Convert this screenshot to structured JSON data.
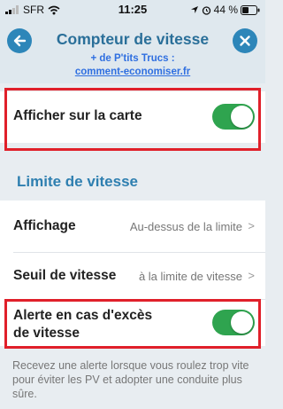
{
  "status": {
    "carrier": "SFR",
    "time": "11:25",
    "battery": "44 %"
  },
  "header": {
    "title": "Compteur de vitesse",
    "watermark_line1": "+ de P'tits Trucs :",
    "watermark_line2": "comment-economiser.fr"
  },
  "rows": {
    "show_on_map": {
      "label": "Afficher sur la carte",
      "enabled": true
    },
    "section_title": "Limite de vitesse",
    "display": {
      "label": "Affichage",
      "value": "Au-dessus de la limite"
    },
    "threshold": {
      "label": "Seuil de vitesse",
      "value": "à la limite de vitesse"
    },
    "alert": {
      "label_line1": "Alerte en cas d'excès",
      "label_line2": "de vitesse",
      "enabled": true
    }
  },
  "footnote": "Recevez une alerte lorsque vous roulez trop vite pour éviter les PV et adopter une conduite plus sûre.",
  "colors": {
    "accent": "#2d86b9",
    "toggle_on": "#2fa44f",
    "highlight": "#e0202a"
  }
}
